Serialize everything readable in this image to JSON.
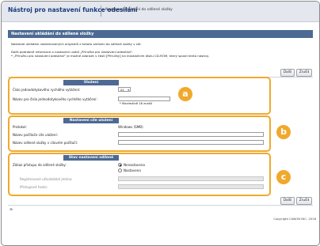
{
  "header": {
    "app_title": "Nástroj pro nastavení funkce odesílání",
    "breadcrumb": "Nastavení ukládání do sdílené složky"
  },
  "page": {
    "section_title": "Nastavení ukládání do sdílené složky",
    "intro": "Nastavte ukládání naskenovaných originálů z tohoto zařízení do sdílené složky v síti.",
    "note_line1": "Další podrobné informace o nastavení uvádí „Příručka pro nastavení odesílání\".",
    "note_line2": "* „Příručku pro nastavení odesílání\" je možné zobrazit v části [Příručky] na instalačním disku CD-ROM, který spustí tento nástroj."
  },
  "buttons": {
    "ok": "Další",
    "cancel": "Zrušit"
  },
  "registration": {
    "title": "Uložení",
    "speed_dial_label": "Číslo jednodotykového rychlého vytáčení:",
    "speed_dial_value": "01",
    "name_label": "Název pro číslo jednodotykového rychlého vytáčení:",
    "name_value": "",
    "name_hint": "* Maximálně 16 znaků"
  },
  "destination": {
    "title": "Nastavení cíle uložení",
    "protocol_label": "Protokol:",
    "protocol_value": "Windows (SMB)",
    "host_label": "Název počítače cíle uložení:",
    "host_value": "",
    "folder_label": "Název sdílené složky v cílovém počítači:",
    "folder_value": ""
  },
  "shared_folder": {
    "title": "Stav nastavení sdílené složky",
    "auth_label": "Zákaz přístupu do sdílené složky:",
    "option_not_set": "Nenastaveno",
    "option_set": "Nastaveno",
    "selected": "Nenastaveno",
    "username_label": "Registrované uživatelské jméno:",
    "password_label": "Přístupové heslo:"
  },
  "callouts": {
    "a": "a",
    "b": "b",
    "c": "c"
  },
  "footer": {
    "top_link": "≥",
    "copyright": "Copyright CANON INC. 2016"
  },
  "colors": {
    "accent": "#f0a92d",
    "section_header": "#4c6a93",
    "title_text": "#1a3b7a"
  }
}
